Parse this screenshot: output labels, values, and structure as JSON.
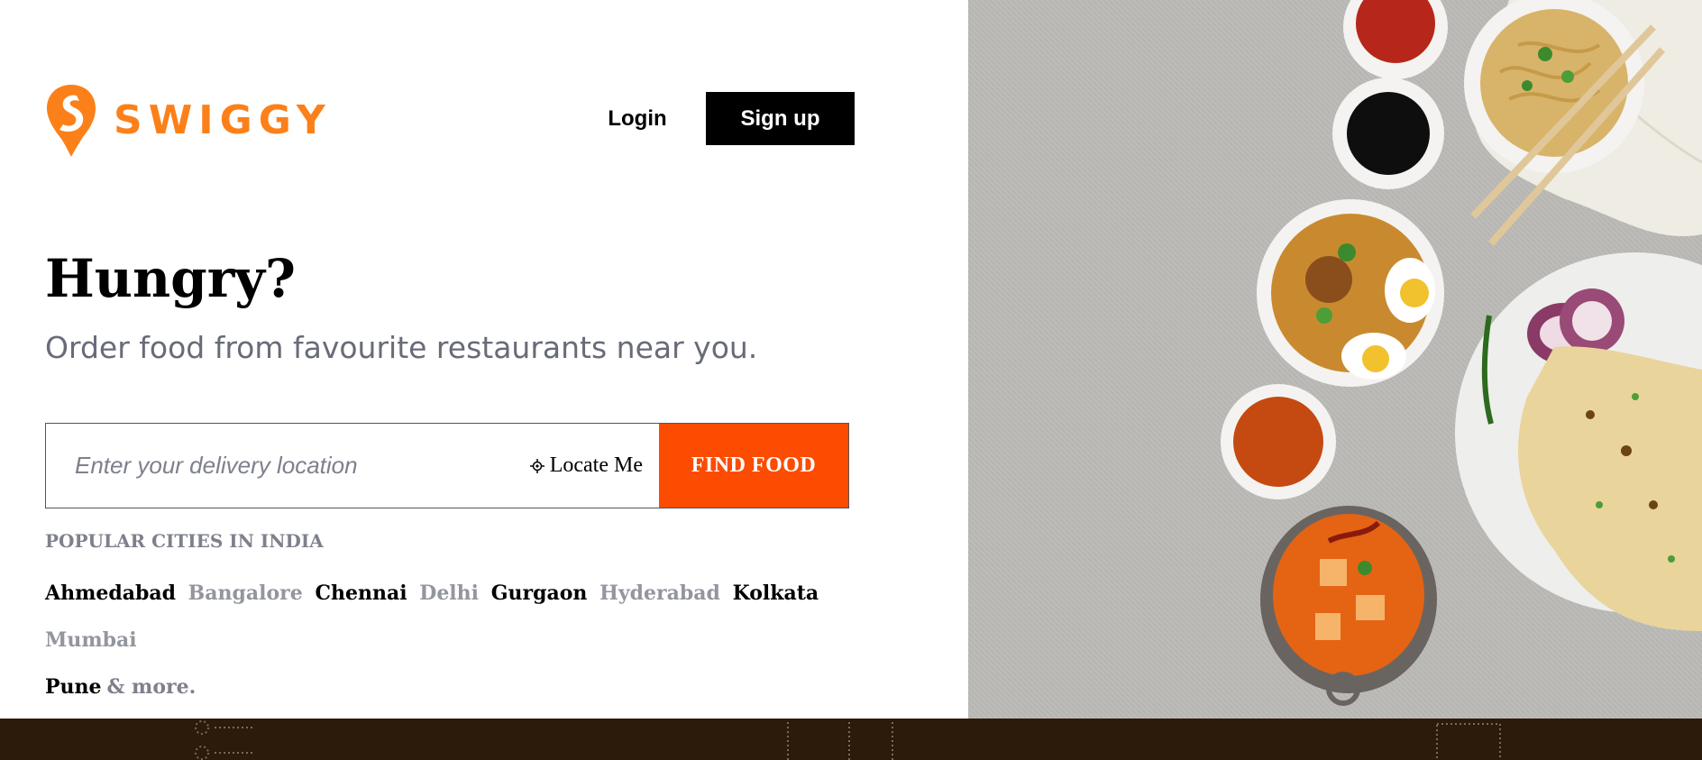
{
  "brand": {
    "name": "SWIGGY",
    "color": "#fc8019"
  },
  "header": {
    "login_label": "Login",
    "signup_label": "Sign up"
  },
  "hero": {
    "title": "Hungry?",
    "subtitle": "Order food from favourite restaurants near you."
  },
  "search": {
    "placeholder": "Enter your delivery location",
    "locate_label": "Locate Me",
    "find_label": "FIND FOOD",
    "accent": "#fc4c02"
  },
  "popular": {
    "title": "POPULAR CITIES IN INDIA",
    "cities": [
      "Ahmedabad",
      "Bangalore",
      "Chennai",
      "Delhi",
      "Gurgaon",
      "Hyderabad",
      "Kolkata",
      "Mumbai",
      "Pune"
    ],
    "more_label": "& more."
  },
  "footer": {
    "color": "#2c1a0b"
  }
}
